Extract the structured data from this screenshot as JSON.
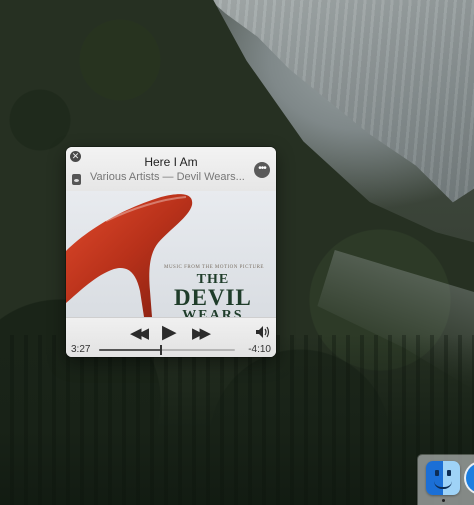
{
  "mini_player": {
    "track_title": "Here I Am",
    "track_subtitle": "Various Artists — Devil Wears...",
    "more_button_label": "•••",
    "close_button_label": "✕",
    "artwork": {
      "tagline": "MUSIC FROM THE MOTION PICTURE",
      "title_line1": "THE",
      "title_line2": "DEVIL",
      "title_line3": "WEARS",
      "shoe_color": "#c0391f"
    },
    "playback": {
      "elapsed": "3:27",
      "remaining": "-4:10",
      "progress_fraction": 0.454
    },
    "icons": {
      "rewind": "rewind-icon",
      "play": "play-icon",
      "forward": "fast-forward-icon",
      "volume": "volume-icon",
      "album": "album-icon"
    }
  },
  "dock": {
    "apps": [
      "Finder",
      "Safari"
    ]
  }
}
